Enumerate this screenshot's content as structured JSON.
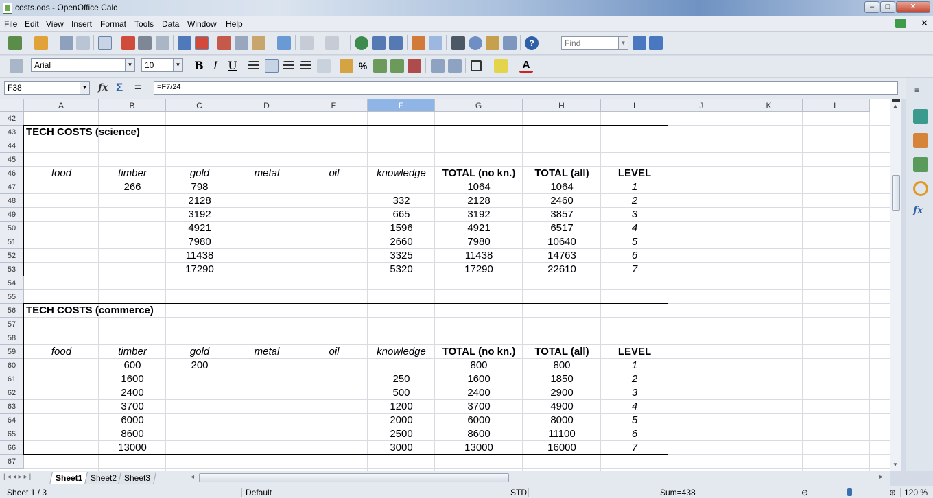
{
  "window": {
    "title": "costs.ods - OpenOffice Calc",
    "min": "–",
    "max": "□",
    "close": "✕"
  },
  "menu": [
    "File",
    "Edit",
    "View",
    "Insert",
    "Format",
    "Tools",
    "Data",
    "Window",
    "Help"
  ],
  "toolbar": {
    "find_placeholder": "Find",
    "font_name": "Arial",
    "font_size": "10",
    "bold": "B",
    "italic": "I",
    "underline": "U"
  },
  "formula": {
    "cell_ref": "F38",
    "content": "=F7/24",
    "fx": "fx",
    "sum": "Σ",
    "eq": "="
  },
  "columns": [
    {
      "label": "A",
      "w": 109
    },
    {
      "label": "B",
      "w": 98
    },
    {
      "label": "C",
      "w": 98
    },
    {
      "label": "D",
      "w": 98
    },
    {
      "label": "E",
      "w": 98
    },
    {
      "label": "F",
      "w": 98
    },
    {
      "label": "G",
      "w": 128
    },
    {
      "label": "H",
      "w": 114
    },
    {
      "label": "I",
      "w": 98
    },
    {
      "label": "J",
      "w": 98
    },
    {
      "label": "K",
      "w": 98
    },
    {
      "label": "L",
      "w": 98
    }
  ],
  "selected_column": "F",
  "row_numbers": [
    "42",
    "43",
    "44",
    "45",
    "46",
    "47",
    "48",
    "49",
    "50",
    "51",
    "52",
    "53",
    "54",
    "55",
    "56",
    "57",
    "58",
    "59",
    "60",
    "61",
    "62",
    "63",
    "64",
    "65",
    "66",
    "67"
  ],
  "sections": [
    {
      "title": "TECH COSTS (science)",
      "headers": [
        "food",
        "timber",
        "gold",
        "metal",
        "oil",
        "knowledge",
        "TOTAL (no kn.)",
        "TOTAL (all)",
        "LEVEL"
      ],
      "rows": [
        [
          "",
          "266",
          "798",
          "",
          "",
          "",
          "1064",
          "1064",
          "1"
        ],
        [
          "",
          "",
          "2128",
          "",
          "",
          "332",
          "2128",
          "2460",
          "2"
        ],
        [
          "",
          "",
          "3192",
          "",
          "",
          "665",
          "3192",
          "3857",
          "3"
        ],
        [
          "",
          "",
          "4921",
          "",
          "",
          "1596",
          "4921",
          "6517",
          "4"
        ],
        [
          "",
          "",
          "7980",
          "",
          "",
          "2660",
          "7980",
          "10640",
          "5"
        ],
        [
          "",
          "",
          "11438",
          "",
          "",
          "3325",
          "11438",
          "14763",
          "6"
        ],
        [
          "",
          "",
          "17290",
          "",
          "",
          "5320",
          "17290",
          "22610",
          "7"
        ]
      ]
    },
    {
      "title": "TECH COSTS (commerce)",
      "headers": [
        "food",
        "timber",
        "gold",
        "metal",
        "oil",
        "knowledge",
        "TOTAL (no kn.)",
        "TOTAL (all)",
        "LEVEL"
      ],
      "rows": [
        [
          "",
          "600",
          "200",
          "",
          "",
          "",
          "800",
          "800",
          "1"
        ],
        [
          "",
          "1600",
          "",
          "",
          "",
          "250",
          "1600",
          "1850",
          "2"
        ],
        [
          "",
          "2400",
          "",
          "",
          "",
          "500",
          "2400",
          "2900",
          "3"
        ],
        [
          "",
          "3700",
          "",
          "",
          "",
          "1200",
          "3700",
          "4900",
          "4"
        ],
        [
          "",
          "6000",
          "",
          "",
          "",
          "2000",
          "6000",
          "8000",
          "5"
        ],
        [
          "",
          "8600",
          "",
          "",
          "",
          "2500",
          "8600",
          "11100",
          "6"
        ],
        [
          "",
          "13000",
          "",
          "",
          "",
          "3000",
          "13000",
          "16000",
          "7"
        ]
      ]
    }
  ],
  "sheets": [
    "Sheet1",
    "Sheet2",
    "Sheet3"
  ],
  "active_sheet": "Sheet1",
  "status": {
    "sheet": "Sheet 1 / 3",
    "style": "Default",
    "mode": "STD",
    "sum": "Sum=438",
    "zoom": "120 %"
  }
}
